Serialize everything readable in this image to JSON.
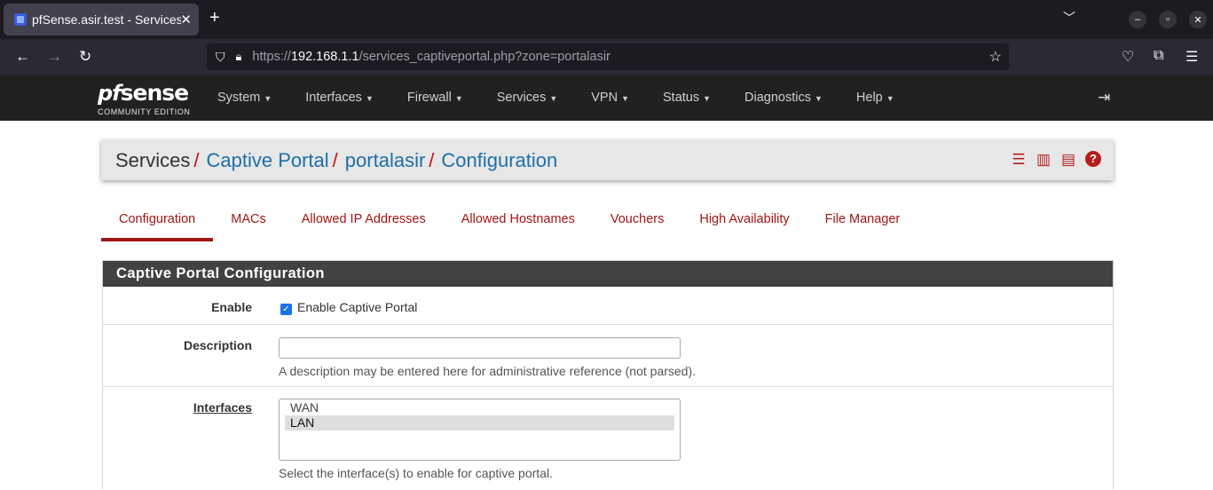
{
  "browser": {
    "tab_title": "pfSense.asir.test - Services: Captive Portal",
    "url_scheme": "https://",
    "url_host": "192.168.1.1",
    "url_path": "/services_captiveportal.php?zone=portalasir"
  },
  "header": {
    "logo_pf": "pf",
    "logo_sense": "sense",
    "logo_edition": "COMMUNITY EDITION",
    "menu": [
      "System",
      "Interfaces",
      "Firewall",
      "Services",
      "VPN",
      "Status",
      "Diagnostics",
      "Help"
    ]
  },
  "breadcrumb": {
    "root": "Services",
    "items": [
      "Captive Portal",
      "portalasir",
      "Configuration"
    ],
    "separator": "/"
  },
  "tabs": [
    "Configuration",
    "MACs",
    "Allowed IP Addresses",
    "Allowed Hostnames",
    "Vouchers",
    "High Availability",
    "File Manager"
  ],
  "panel": {
    "title": "Captive Portal Configuration",
    "enable": {
      "label": "Enable",
      "checkbox_label": "Enable Captive Portal",
      "checked": true
    },
    "description": {
      "label": "Description",
      "value": "",
      "help": "A description may be entered here for administrative reference (not parsed)."
    },
    "interfaces": {
      "label": "Interfaces",
      "options": [
        "WAN",
        "LAN"
      ],
      "selected": "LAN",
      "help": "Select the interface(s) to enable for captive portal."
    }
  },
  "colors": {
    "accent": "#a31515",
    "link": "#1f6fa9",
    "header_bg": "#212121"
  }
}
